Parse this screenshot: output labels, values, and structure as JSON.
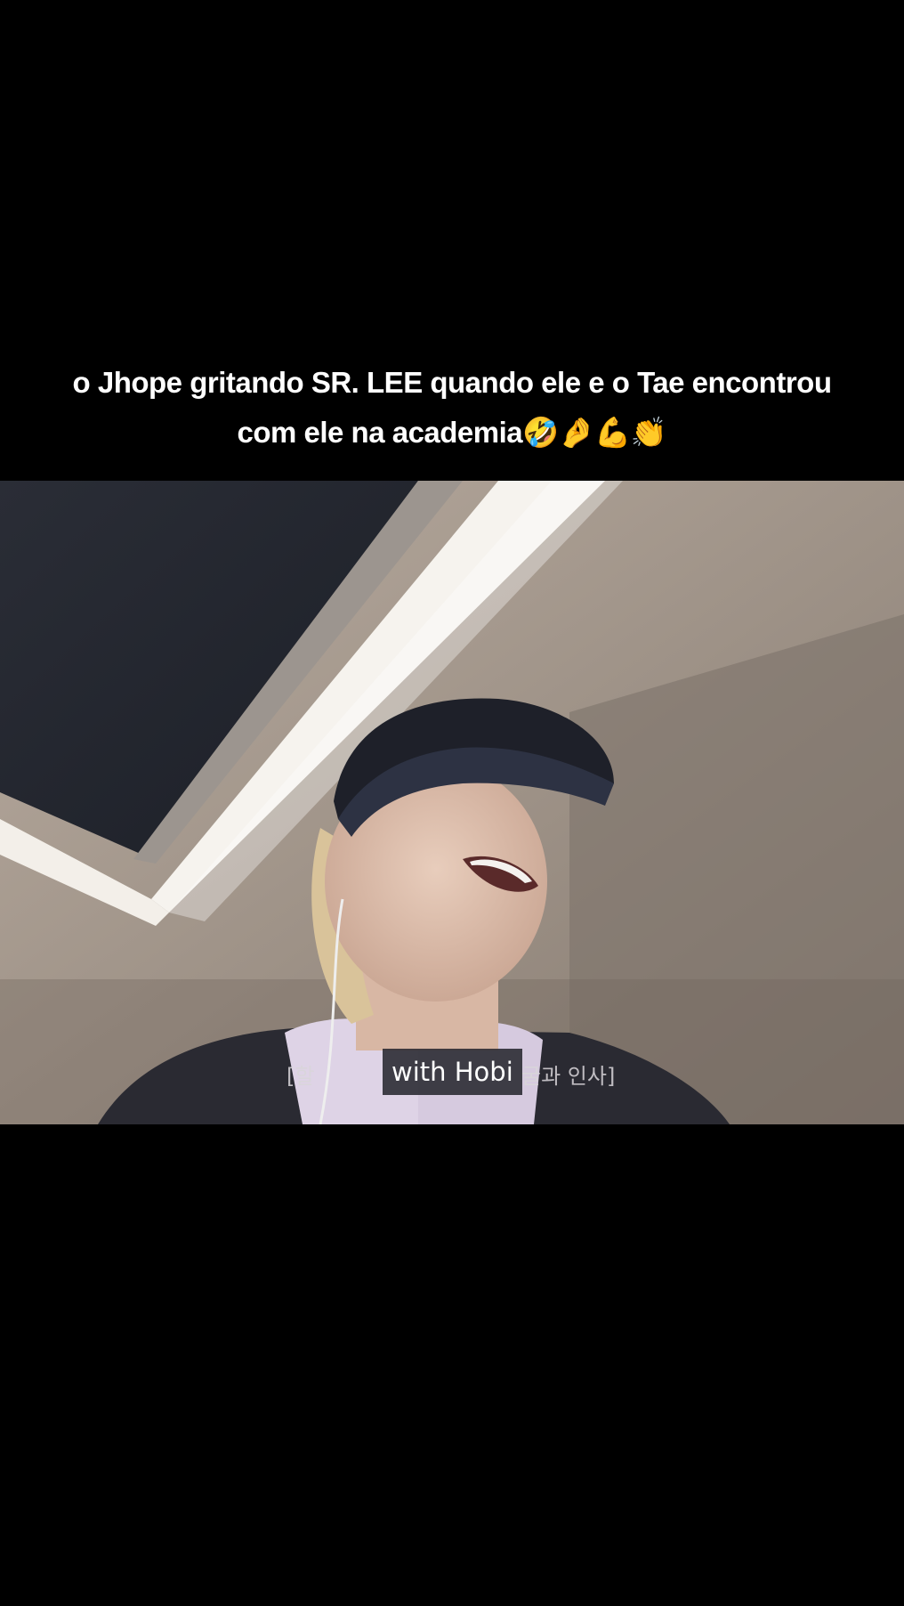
{
  "caption": {
    "line1": "o Jhope gritando SR. LEE quando ele e o Tae encontrou",
    "line2": "com ele na academia",
    "emojis": "🤣🤌💪👏"
  },
  "video": {
    "subtitle_main": "with Hobi",
    "subtitle_korean_left": "[할 ",
    "subtitle_korean_right": "굴과 인사]"
  }
}
